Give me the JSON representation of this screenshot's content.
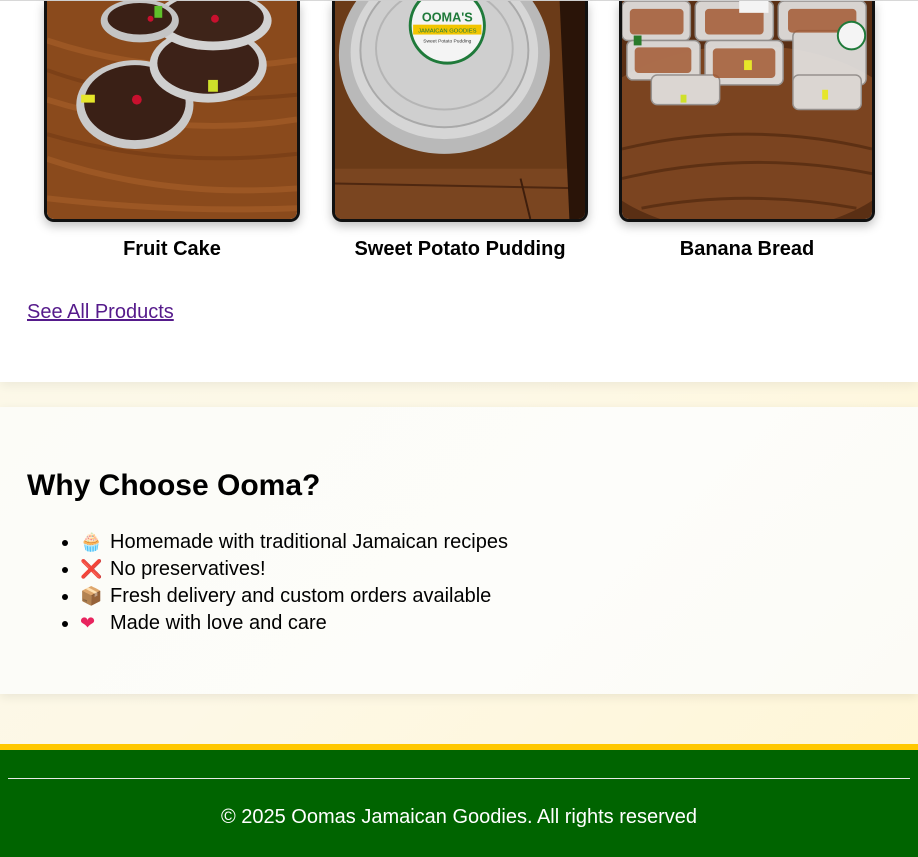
{
  "products": [
    {
      "name": "Fruit Cake"
    },
    {
      "name": "Sweet Potato Pudding"
    },
    {
      "name": "Banana Bread"
    }
  ],
  "product_label_text": {
    "brand": "OOMA'S",
    "sub": "JAMAICAN GOODIES",
    "small": "Sweet Potato Pudding"
  },
  "see_all_link": "See All Products",
  "why": {
    "heading": "Why Choose Ooma?",
    "items": [
      {
        "emoji": "🧁",
        "text": "Homemade with traditional Jamaican recipes"
      },
      {
        "emoji": "❌",
        "text": "No preservatives!"
      },
      {
        "emoji": "📦",
        "text": "Fresh delivery and custom orders available"
      },
      {
        "emoji": "❤",
        "text": "Made with love and care"
      }
    ]
  },
  "footer": {
    "copyright": "© 2025 Oomas Jamaican Goodies. All rights reserved"
  },
  "colors": {
    "footer_bg": "#006400",
    "footer_border": "#ffc800",
    "link": "#551a8b"
  }
}
